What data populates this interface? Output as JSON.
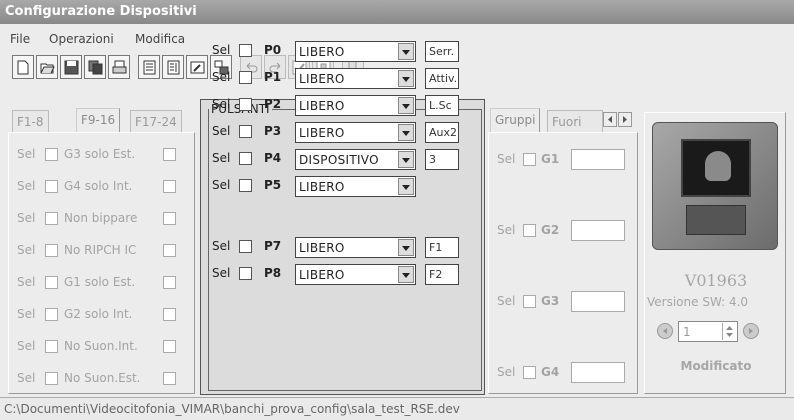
{
  "window": {
    "title": "Configurazione Dispositivi"
  },
  "menu": {
    "items": [
      "File",
      "Operazioni",
      "Modifica"
    ]
  },
  "toolbar": {
    "buttons": [
      {
        "icon": "new-file-icon",
        "enabled": true
      },
      {
        "icon": "open-folder-icon",
        "enabled": true
      },
      {
        "icon": "save-icon",
        "enabled": true
      },
      {
        "icon": "copy-icon",
        "enabled": true
      },
      {
        "icon": "print-icon",
        "enabled": true
      },
      {
        "icon": "list-icon",
        "enabled": true
      },
      {
        "icon": "list-edit-icon",
        "enabled": true
      },
      {
        "icon": "edit-icon",
        "enabled": true
      },
      {
        "icon": "layout-icon",
        "enabled": true
      },
      {
        "icon": "undo-icon",
        "enabled": false
      },
      {
        "icon": "redo-icon",
        "enabled": false
      },
      {
        "icon": "check-icon",
        "enabled": false
      },
      {
        "icon": "window-icon",
        "enabled": false
      },
      {
        "icon": "exit-icon",
        "enabled": false
      }
    ]
  },
  "left_panel": {
    "tabs": [
      "F1-8",
      "F9-16",
      "F17-24"
    ],
    "active_tab": 1,
    "sel_label": "Sel",
    "rows": [
      "G3 solo Est.",
      "G4 solo Int.",
      "Non bippare",
      "No RIPCH IC",
      "G1 solo Est.",
      "G2 solo Int.",
      "No Suon.Int.",
      "No Suon.Est."
    ]
  },
  "pulsanti": {
    "title": "PULSANTI",
    "sel_label": "Sel",
    "rows": [
      {
        "key": "P0",
        "value": "LIBERO",
        "field": "Serr."
      },
      {
        "key": "P1",
        "value": "LIBERO",
        "field": "Attiv."
      },
      {
        "key": "P2",
        "value": "LIBERO",
        "field": "L.Sc"
      },
      {
        "key": "P3",
        "value": "LIBERO",
        "field": "Aux2"
      },
      {
        "key": "P4",
        "value": "DISPOSITIVO",
        "field": "3"
      },
      {
        "key": "P5",
        "value": "LIBERO",
        "field": null
      },
      {
        "key": "P7",
        "value": "LIBERO",
        "field": "F1"
      },
      {
        "key": "P8",
        "value": "LIBERO",
        "field": "F2"
      }
    ]
  },
  "gruppi": {
    "tabs": [
      "Gruppi",
      "Fuori"
    ],
    "sel_label": "Sel",
    "groups": [
      "G1",
      "G2",
      "G3",
      "G4"
    ]
  },
  "device": {
    "model": "V01963",
    "version": "Versione SW: 4.0",
    "spinner_value": "1",
    "status": "Modificato"
  },
  "statusbar": {
    "path": "C:\\Documenti\\Videocitofonia_VIMAR\\banchi_prova_config\\sala_test_RSE.dev"
  }
}
